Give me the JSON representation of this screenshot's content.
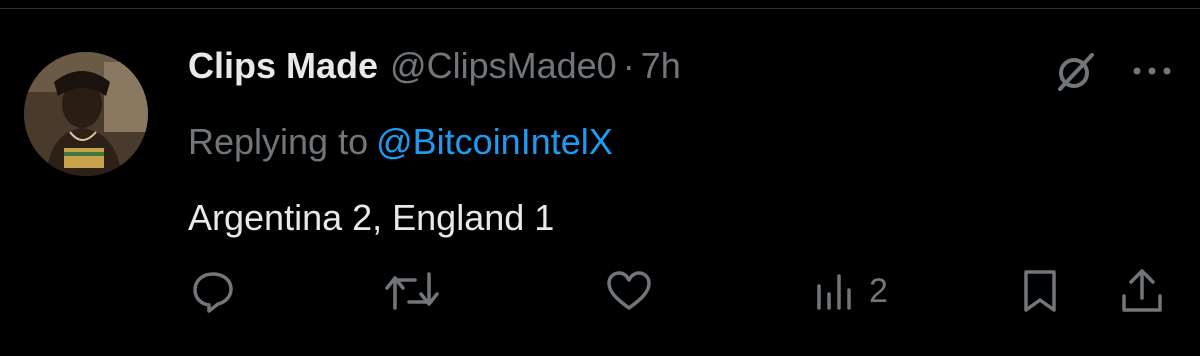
{
  "tweet": {
    "display_name": "Clips Made",
    "handle": "@ClipsMade0",
    "separator": "·",
    "time": "7h",
    "reply_prefix": "Replying to",
    "reply_to": "@BitcoinIntelX",
    "text": "Argentina 2, England 1"
  },
  "actions": {
    "reply_icon": "reply-icon",
    "retweet_icon": "retweet-icon",
    "like_icon": "heart-icon",
    "views_icon": "views-icon",
    "views_count": "2",
    "bookmark_icon": "bookmark-icon",
    "share_icon": "share-icon"
  },
  "top_icons": {
    "grok_icon": "grok-icon",
    "more_icon": "more-icon"
  },
  "colors": {
    "background": "#000000",
    "text_primary": "#e7e9ea",
    "text_secondary": "#71767b",
    "link": "#1d9bf0",
    "divider": "#2f3336"
  }
}
